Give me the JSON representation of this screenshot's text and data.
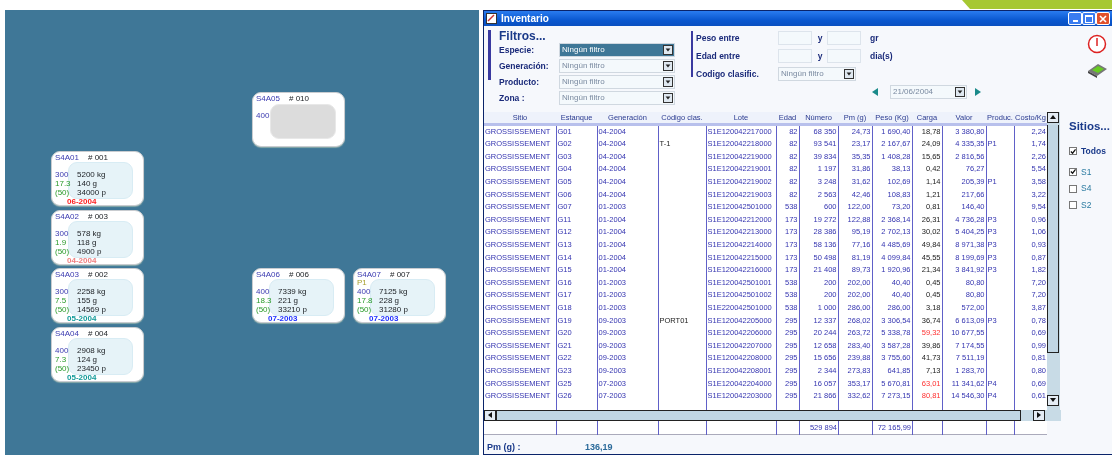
{
  "tanks": [
    {
      "kind": "empty",
      "code": "S4A05",
      "number": "# 010",
      "values": [
        "400"
      ]
    },
    {
      "kind": "stocked",
      "code": "S4A01",
      "number": "# 001",
      "values": [
        "300",
        "17.3",
        "(50)"
      ],
      "amounts": [
        "5200 kg",
        "140 g",
        "34000 p"
      ],
      "date": "06-2004",
      "color": "#ff2020"
    },
    {
      "kind": "stocked",
      "code": "S4A02",
      "number": "# 003",
      "values": [
        "300",
        "1.9",
        "(50)"
      ],
      "amounts": [
        "578 kg",
        "118 g",
        "4900 p"
      ],
      "date": "04-2004",
      "color": "#f08080"
    },
    {
      "kind": "stocked",
      "code": "S4A03",
      "number": "# 002",
      "values": [
        "300",
        "7.5",
        "(50)"
      ],
      "amounts": [
        "2258 kg",
        "155 g",
        "14569 p"
      ],
      "date": "05-2004",
      "color": "#139a9a"
    },
    {
      "kind": "stocked",
      "code": "S4A04",
      "number": "# 004",
      "values": [
        "400",
        "7.3",
        "(50)"
      ],
      "amounts": [
        "2908 kg",
        "124 g",
        "23450 p"
      ],
      "date": "05-2004",
      "color": "#139a9a"
    },
    {
      "kind": "stocked",
      "code": "S4A06",
      "number": "# 006",
      "values": [
        "400",
        "18.3",
        "(50)"
      ],
      "amounts": [
        "7339 kg",
        "221 g",
        "33210 p"
      ],
      "date": "07-2003",
      "color": "#2030ff"
    },
    {
      "kind": "stocked",
      "code": "S4A07",
      "number": "# 007",
      "product": "P1",
      "values": [
        "400",
        "17.8",
        "(50)"
      ],
      "amounts": [
        "7125 kg",
        "228 g",
        "31280 p"
      ],
      "date": "07-2003",
      "color": "#2030ff"
    }
  ],
  "window": {
    "title": "Inventario"
  },
  "filters": {
    "title": "Filtros...",
    "selects": [
      {
        "label": "Especie:",
        "value": "Ningún filtro",
        "selected": true
      },
      {
        "label": "Generación:",
        "value": "Ningún filtro",
        "selected": false
      },
      {
        "label": "Producto:",
        "value": "Ningún filtro",
        "selected": false
      },
      {
        "label": "Zona :",
        "value": "Ningún filtro",
        "selected": false
      }
    ],
    "ranges": [
      {
        "label": "Peso entre",
        "joiner": "y",
        "unit": "gr"
      },
      {
        "label": "Edad entre",
        "joiner": "y",
        "unit": "dia(s)"
      }
    ],
    "classification": {
      "label": "Codigo clasific.",
      "value": "Ningún filtro"
    },
    "date": "21/06/2004"
  },
  "table": {
    "columns": [
      "Sitio",
      "Estanque",
      "Generación",
      "Código clas.",
      "Lote",
      "Edad",
      "Número",
      "Pm (g)",
      "Peso (Kg)",
      "Carga",
      "Valor",
      "Produc.",
      "Costo/Kg"
    ],
    "rows": [
      {
        "alert": false,
        "cells": [
          "GROSSISSEMENT",
          "G01",
          "04-2004",
          "",
          "S1E120042217000",
          "82",
          "68 350",
          "24,73",
          "1 690,40",
          "18,78",
          "3 380,80",
          "",
          "2,24"
        ]
      },
      {
        "alert": false,
        "cells": [
          "GROSSISSEMENT",
          "G02",
          "04-2004",
          "T-1",
          "S1E120042218000",
          "82",
          "93 541",
          "23,17",
          "2 167,67",
          "24,09",
          "4 335,35",
          "P1",
          "1,74"
        ]
      },
      {
        "alert": false,
        "cells": [
          "GROSSISSEMENT",
          "G03",
          "04-2004",
          "",
          "S1E120042219000",
          "82",
          "39 834",
          "35,35",
          "1 408,28",
          "15,65",
          "2 816,56",
          "",
          "2,26"
        ]
      },
      {
        "alert": false,
        "cells": [
          "GROSSISSEMENT",
          "G04",
          "04-2004",
          "",
          "S1E120042219001",
          "82",
          "1 197",
          "31,86",
          "38,13",
          "0,42",
          "76,27",
          "",
          "5,54"
        ]
      },
      {
        "alert": false,
        "cells": [
          "GROSSISSEMENT",
          "G05",
          "04-2004",
          "",
          "S1E120042219002",
          "82",
          "3 248",
          "31,62",
          "102,69",
          "1,14",
          "205,39",
          "P1",
          "3,58"
        ]
      },
      {
        "alert": false,
        "cells": [
          "GROSSISSEMENT",
          "G06",
          "04-2004",
          "",
          "S1E120042219003",
          "82",
          "2 563",
          "42,46",
          "108,83",
          "1,21",
          "217,66",
          "",
          "3,22"
        ]
      },
      {
        "alert": false,
        "cells": [
          "GROSSISSEMENT",
          "G07",
          "01-2003",
          "",
          "S1E120042501000",
          "538",
          "600",
          "122,00",
          "73,20",
          "0,81",
          "146,40",
          "",
          "9,54"
        ]
      },
      {
        "alert": false,
        "cells": [
          "GROSSISSEMENT",
          "G11",
          "01-2004",
          "",
          "S1E120042212000",
          "173",
          "19 272",
          "122,88",
          "2 368,14",
          "26,31",
          "4 736,28",
          "P3",
          "0,96"
        ]
      },
      {
        "alert": false,
        "cells": [
          "GROSSISSEMENT",
          "G12",
          "01-2004",
          "",
          "S1E120042213000",
          "173",
          "28 386",
          "95,19",
          "2 702,13",
          "30,02",
          "5 404,25",
          "P3",
          "1,06"
        ]
      },
      {
        "alert": false,
        "cells": [
          "GROSSISSEMENT",
          "G13",
          "01-2004",
          "",
          "S1E120042214000",
          "173",
          "58 136",
          "77,16",
          "4 485,69",
          "49,84",
          "8 971,38",
          "P3",
          "0,93"
        ]
      },
      {
        "alert": false,
        "cells": [
          "GROSSISSEMENT",
          "G14",
          "01-2004",
          "",
          "S1E120042215000",
          "173",
          "50 498",
          "81,19",
          "4 099,84",
          "45,55",
          "8 199,69",
          "P3",
          "0,87"
        ]
      },
      {
        "alert": false,
        "cells": [
          "GROSSISSEMENT",
          "G15",
          "01-2004",
          "",
          "S1E120042216000",
          "173",
          "21 408",
          "89,73",
          "1 920,96",
          "21,34",
          "3 841,92",
          "P3",
          "1,82"
        ]
      },
      {
        "alert": false,
        "cells": [
          "GROSSISSEMENT",
          "G16",
          "01-2003",
          "",
          "S1E120042501001",
          "538",
          "200",
          "202,00",
          "40,40",
          "0,45",
          "80,80",
          "",
          "7,20"
        ]
      },
      {
        "alert": false,
        "cells": [
          "GROSSISSEMENT",
          "G17",
          "01-2003",
          "",
          "S1E120042501002",
          "538",
          "200",
          "202,00",
          "40,40",
          "0,45",
          "80,80",
          "",
          "7,20"
        ]
      },
      {
        "alert": false,
        "cells": [
          "GROSSISSEMENT",
          "G18",
          "01-2003",
          "",
          "S1E220042501000",
          "538",
          "1 000",
          "286,00",
          "286,00",
          "3,18",
          "572,00",
          "",
          "3,87"
        ]
      },
      {
        "alert": false,
        "cells": [
          "GROSSISSEMENT",
          "G19",
          "09-2003",
          "PORT01",
          "S1E120042205000",
          "295",
          "12 337",
          "268,02",
          "3 306,54",
          "36,74",
          "6 613,09",
          "P3",
          "0,78"
        ]
      },
      {
        "alert": true,
        "cells": [
          "GROSSISSEMENT",
          "G20",
          "09-2003",
          "",
          "S1E120042206000",
          "295",
          "20 244",
          "263,72",
          "5 338,78",
          "59,32",
          "10 677,55",
          "",
          "0,69"
        ]
      },
      {
        "alert": false,
        "cells": [
          "GROSSISSEMENT",
          "G21",
          "09-2003",
          "",
          "S1E120042207000",
          "295",
          "12 658",
          "283,40",
          "3 587,28",
          "39,86",
          "7 174,55",
          "",
          "0,99"
        ]
      },
      {
        "alert": false,
        "cells": [
          "GROSSISSEMENT",
          "G22",
          "09-2003",
          "",
          "S1E120042208000",
          "295",
          "15 656",
          "239,88",
          "3 755,60",
          "41,73",
          "7 511,19",
          "",
          "0,81"
        ]
      },
      {
        "alert": false,
        "cells": [
          "GROSSISSEMENT",
          "G23",
          "09-2003",
          "",
          "S1E120042208001",
          "295",
          "2 344",
          "273,83",
          "641,85",
          "7,13",
          "1 283,70",
          "",
          "0,80"
        ]
      },
      {
        "alert": true,
        "cells": [
          "GROSSISSEMENT",
          "G25",
          "07-2003",
          "",
          "S1E120042204000",
          "295",
          "16 057",
          "353,17",
          "5 670,81",
          "63,01",
          "11 341,62",
          "P4",
          "0,69"
        ]
      },
      {
        "alert": true,
        "cells": [
          "GROSSISSEMENT",
          "G26",
          "07-2003",
          "",
          "S1E120042203000",
          "295",
          "21 866",
          "332,62",
          "7 273,15",
          "80,81",
          "14 546,30",
          "P4",
          "0,61"
        ]
      }
    ],
    "totals": {
      "numero": "529 894",
      "peso": "72 165,99"
    }
  },
  "footer": {
    "label": "Pm (g) :",
    "value": "136,19"
  },
  "sites": {
    "title": "Sitios...",
    "items": [
      {
        "label": "Todos",
        "checked": true,
        "kind": "all"
      },
      {
        "label": "S1",
        "checked": true,
        "kind": "site"
      },
      {
        "label": "S4",
        "checked": false,
        "kind": "site"
      },
      {
        "label": "S2",
        "checked": false,
        "kind": "site"
      }
    ]
  }
}
